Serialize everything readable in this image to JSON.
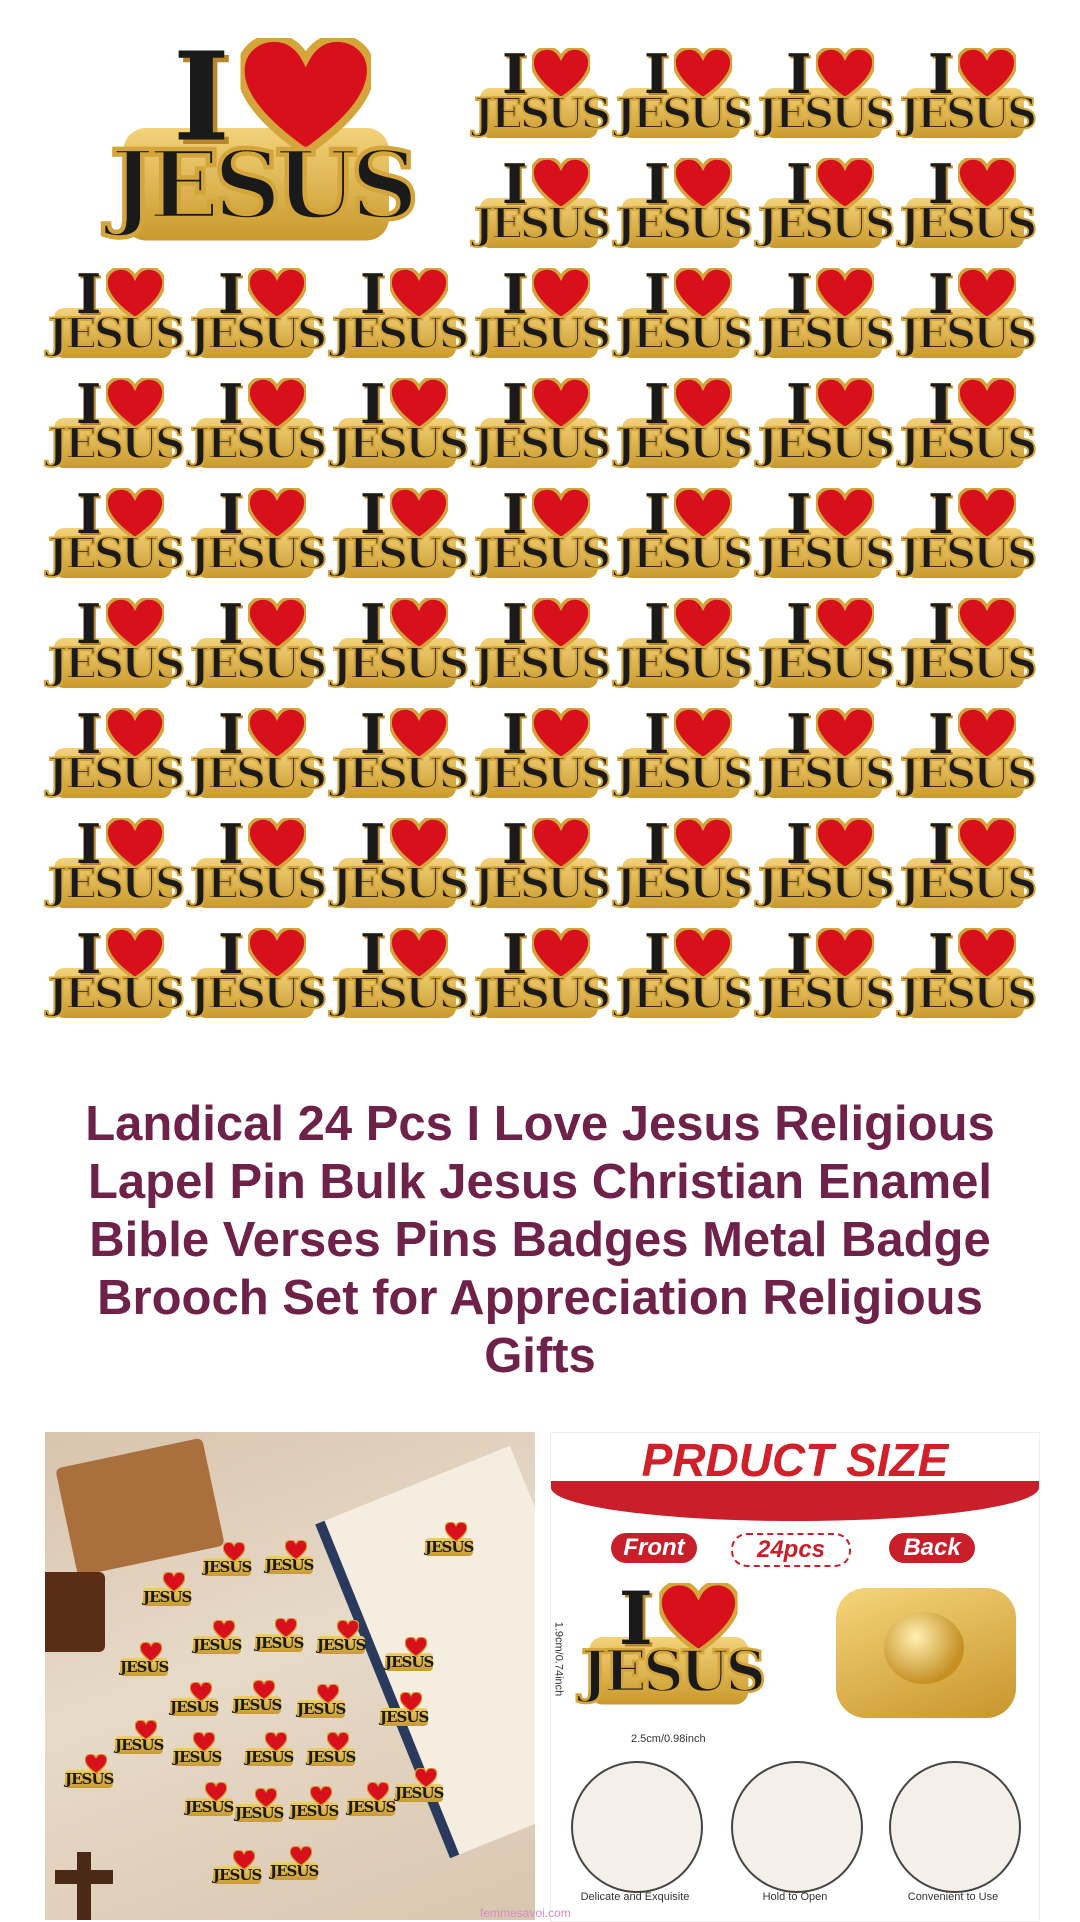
{
  "pin": {
    "i": "I",
    "word": "JESUS"
  },
  "title": "Landical 24 Pcs I Love Jesus Religious Lapel Pin Bulk Jesus Christian Enamel Bible Verses Pins Badges Metal Badge Brooch Set for Appreciation Religious Gifts",
  "size_panel": {
    "title": "PRDUCT SIZE",
    "front": "Front",
    "count": "24pcs",
    "back": "Back",
    "height_dim": "1.9cm/0.74inch",
    "width_dim": "2.5cm/0.98inch",
    "captions": [
      "Delicate and Exquisite",
      "Hold to Open",
      "Convenient to Use"
    ]
  },
  "watermark": "femmesavoi.com",
  "colors": {
    "title": "#6e2149",
    "heart": "#d8101c",
    "gold": "#d4a53a",
    "accent_red": "#c91f2a"
  }
}
